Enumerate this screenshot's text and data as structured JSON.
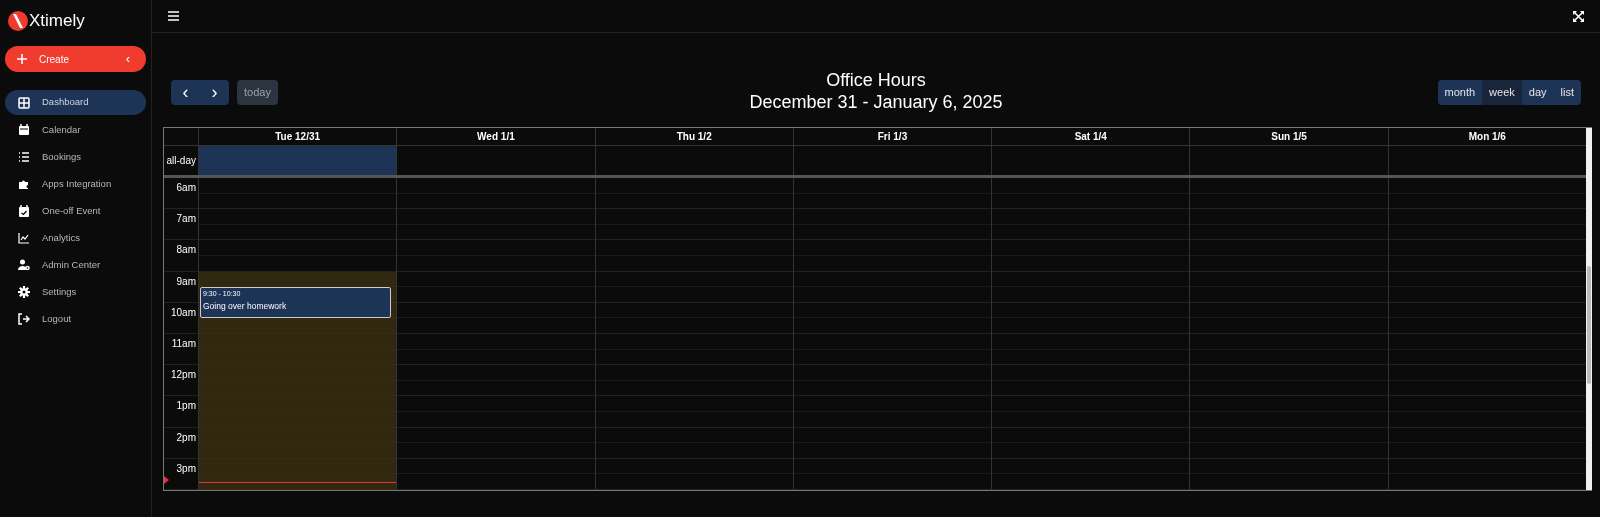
{
  "brand": {
    "name": "Xtimely"
  },
  "create_button": {
    "label": "Create",
    "caret": "‹"
  },
  "sidebar": {
    "items": [
      {
        "label": "Dashboard",
        "selected": true
      },
      {
        "label": "Calendar",
        "selected": false
      },
      {
        "label": "Bookings",
        "selected": false
      },
      {
        "label": "Apps Integration",
        "selected": false
      },
      {
        "label": "One-off Event",
        "selected": false
      },
      {
        "label": "Analytics",
        "selected": false
      },
      {
        "label": "Admin Center",
        "selected": false
      },
      {
        "label": "Settings",
        "selected": false
      },
      {
        "label": "Logout",
        "selected": false
      }
    ]
  },
  "toolbar": {
    "prev": "‹",
    "next": "›",
    "today": "today",
    "title": "Office Hours",
    "range": "December 31 - January 6, 2025",
    "views": [
      {
        "label": "month",
        "selected": false
      },
      {
        "label": "week",
        "selected": true
      },
      {
        "label": "day",
        "selected": false
      },
      {
        "label": "list",
        "selected": false
      }
    ]
  },
  "calendar": {
    "all_day_label": "all-day",
    "days": [
      {
        "label": "Tue 12/31",
        "today": true,
        "events": [
          {
            "time": "9:30 - 10:30",
            "title": "Going over homework"
          }
        ]
      },
      {
        "label": "Wed 1/1",
        "today": false
      },
      {
        "label": "Thu 1/2",
        "today": false
      },
      {
        "label": "Fri 1/3",
        "today": false
      },
      {
        "label": "Sat 1/4",
        "today": false
      },
      {
        "label": "Sun 1/5",
        "today": false
      },
      {
        "label": "Mon 1/6",
        "today": false
      }
    ],
    "hours": [
      "6am",
      "7am",
      "8am",
      "9am",
      "10am",
      "11am",
      "12pm",
      "1pm",
      "2pm",
      "3pm"
    ]
  }
}
